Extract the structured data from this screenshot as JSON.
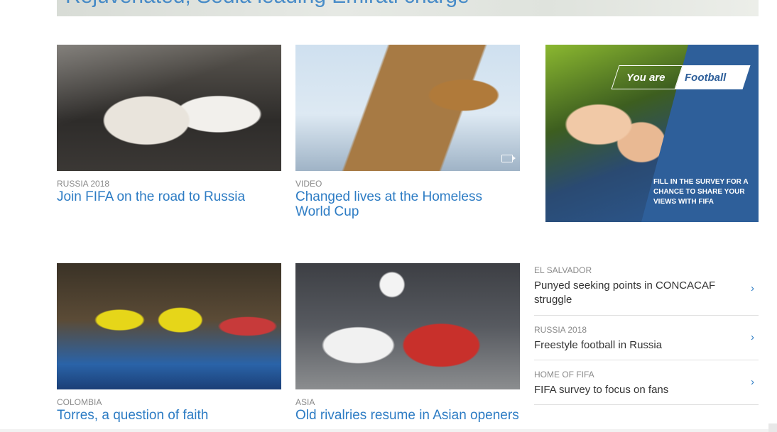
{
  "hero": {
    "title": "Rejuvenated, Sedia leading Emirati charge"
  },
  "cards": [
    {
      "category": "RUSSIA 2018",
      "title": "Join FIFA on the road to Russia"
    },
    {
      "category": "VIDEO",
      "title": "Changed lives at the Homeless World Cup"
    },
    {
      "category": "COLOMBIA",
      "title": "Torres, a question of faith"
    },
    {
      "category": "ASIA",
      "title": "Old rivalries resume in Asian openers"
    }
  ],
  "ad": {
    "tag_left": "You are",
    "tag_right": "Football",
    "survey": "FILL IN THE SURVEY FOR A CHANCE TO SHARE YOUR VIEWS WITH FIFA"
  },
  "side_list": [
    {
      "category": "EL SALVADOR",
      "title": "Punyed seeking points in CONCACAF struggle"
    },
    {
      "category": "RUSSIA 2018",
      "title": "Freestyle football in Russia"
    },
    {
      "category": "HOME OF FIFA",
      "title": "FIFA survey to focus on fans"
    }
  ],
  "icons": {
    "chevron": "chevron-right-icon",
    "video": "video-icon"
  },
  "colors": {
    "link": "#2d7cc4",
    "category": "#8a8a8a",
    "ad_blue": "#2e5f9a"
  }
}
